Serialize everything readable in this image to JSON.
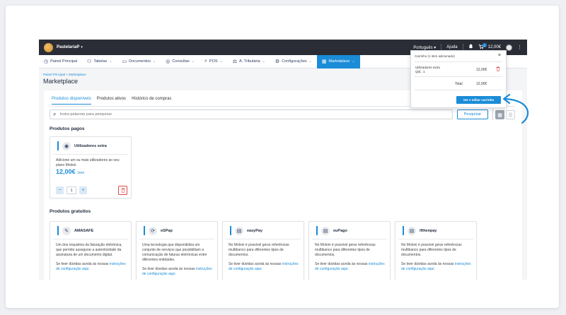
{
  "topbar": {
    "company": "PastelariaP",
    "language": "Português",
    "help": "Ajuda",
    "cart_count": "1",
    "cart_total": "12,00€"
  },
  "nav": {
    "items": [
      {
        "label": "Painel Principal",
        "icon": "home-icon"
      },
      {
        "label": "Tabelas",
        "icon": "people-icon"
      },
      {
        "label": "Documentos",
        "icon": "document-icon"
      },
      {
        "label": "Consultas",
        "icon": "chat-icon"
      },
      {
        "label": "POS",
        "icon": "pos-icon"
      },
      {
        "label": "A. Tributária",
        "icon": "balance-icon"
      },
      {
        "label": "Configurações",
        "icon": "gear-icon"
      },
      {
        "label": "Marketplace",
        "icon": "grid-icon"
      }
    ],
    "active": "Marketplace"
  },
  "breadcrumb": {
    "home": "Painel Principal",
    "sep": ">",
    "current": "Marketplace"
  },
  "page_title": "Marketplace",
  "tabs": [
    "Produtos disponíveis",
    "Produtos ativos",
    "Histórico de compras"
  ],
  "search": {
    "placeholder": "Insira palavras para pesquisar",
    "button": "Pesquisar"
  },
  "paid": {
    "title": "Produtos pagos",
    "product": {
      "name": "Utilizadores extra",
      "description": "Adicione um ou mais utilizadores ao seu plano Moloni.",
      "price": "12,00€",
      "unit": "/ano",
      "quantity": "1",
      "minus": "−",
      "plus": "+"
    }
  },
  "free": {
    "title": "Produtos gratuitos",
    "products": [
      {
        "name": "AMASAFE",
        "description": "Um dos requisitos da faturação eletrónica, que permite assegurar a autenticidade da assinatura de um documento digital.",
        "link_prefix": "Se tiver dúvidas aceda às nossas ",
        "link": "instruções de configuração aqui."
      },
      {
        "name": "eSPap",
        "description": "Uma tecnologia que disponibiliza um conjunto de serviços que possibilitam a comunicação de faturas eletrónicas entre diferentes entidades.",
        "link_prefix": "Se tiver dúvidas aceda às nossas ",
        "link": "instruções de configuração aqui."
      },
      {
        "name": "easyPay",
        "description": "No Moloni é possível gerar referências multibanco para diferentes tipos de documentos.",
        "link_prefix": "Se tiver dúvidas aceda às nossas ",
        "link": "instruções de configuração aqui."
      },
      {
        "name": "euPago",
        "description": "No Moloni é possível gerar referências multibanco para diferentes tipos de documentos.",
        "link_prefix": "Se tiver dúvidas aceda às nossas ",
        "link": "instruções de configuração aqui."
      },
      {
        "name": "ifthenpay",
        "description": "No Moloni é possível gerar referências multibanco para diferentes tipos de documentos.",
        "link_prefix": "Se tiver dúvidas aceda às nossas ",
        "link": "instruções de configuração aqui."
      }
    ]
  },
  "cart": {
    "header": "Carrinho (1 item adicionado)",
    "item_name": "Utilizadores extra",
    "item_qty": "Qtd.: 1",
    "item_price": "12,00€",
    "total_label": "Total",
    "total_value": "12,00€",
    "button": "Ver e editar carrinho"
  },
  "colors": {
    "accent": "#1a8cd8",
    "topbar": "#2b2d36",
    "danger": "#e04848"
  }
}
